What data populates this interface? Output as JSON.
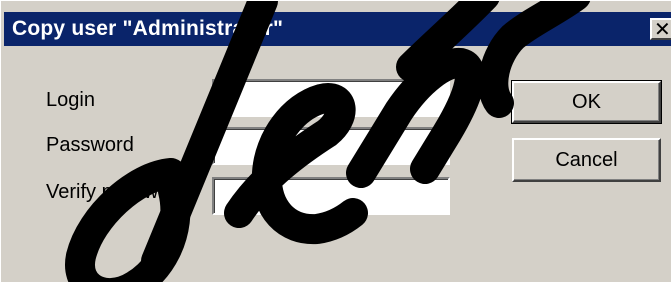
{
  "window": {
    "title": "Copy user \"Administrator\"",
    "close_glyph": "✕"
  },
  "form": {
    "login_label": "Login",
    "login_value": "",
    "password_label": "Password",
    "password_value": "",
    "verify_label": "Verify password",
    "verify_value": ""
  },
  "buttons": {
    "ok_label": "OK",
    "cancel_label": "Cancel"
  },
  "colors": {
    "titlebar": "#0a246a",
    "dialog_bg": "#d4d0c8",
    "watermark": "#000000"
  }
}
